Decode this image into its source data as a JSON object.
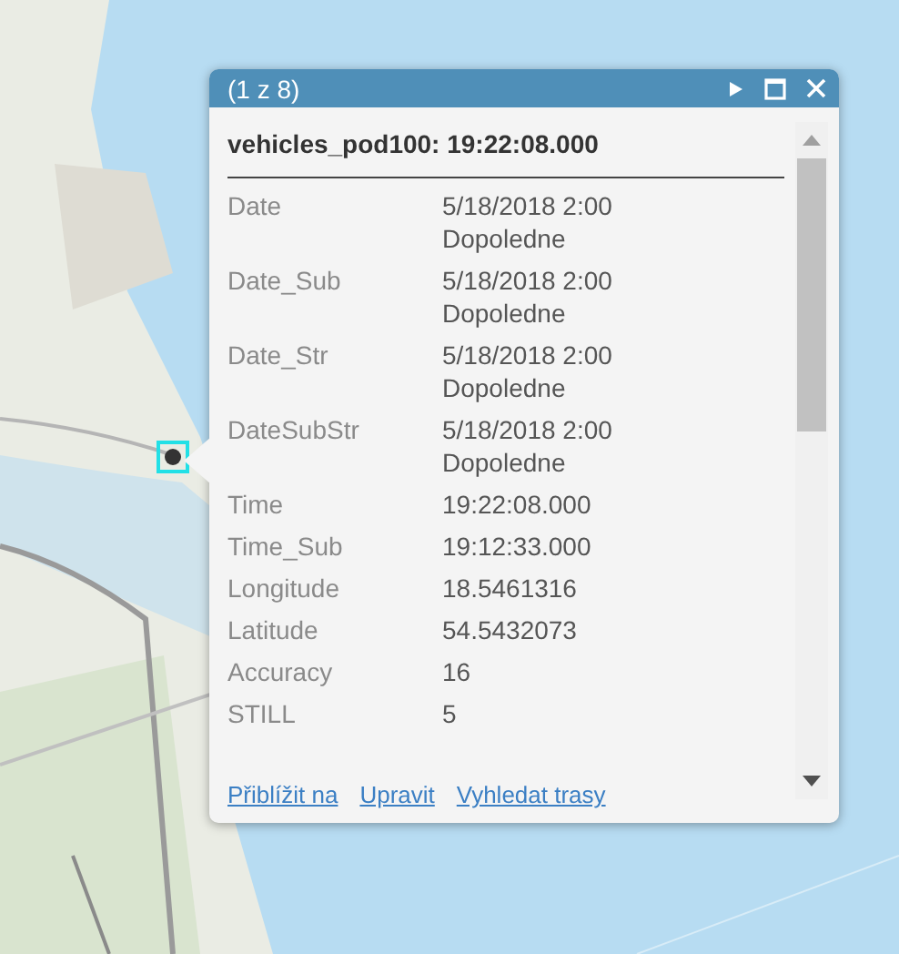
{
  "popup": {
    "title": "(1 z 8)",
    "heading": "vehicles_pod100: 19:22:08.000",
    "fields": [
      {
        "label": "Date",
        "value": "5/18/2018 2:00 Dopoledne"
      },
      {
        "label": "Date_Sub",
        "value": "5/18/2018 2:00 Dopoledne"
      },
      {
        "label": "Date_Str",
        "value": "5/18/2018 2:00 Dopoledne"
      },
      {
        "label": "DateSubStr",
        "value": "5/18/2018 2:00 Dopoledne"
      },
      {
        "label": "Time",
        "value": "19:22:08.000"
      },
      {
        "label": "Time_Sub",
        "value": "19:12:33.000"
      },
      {
        "label": "Longitude",
        "value": "18.5461316"
      },
      {
        "label": "Latitude",
        "value": "54.5432073"
      },
      {
        "label": "Accuracy",
        "value": "16"
      },
      {
        "label": "STILL",
        "value": "5"
      }
    ],
    "actions": [
      "Přiblížit na",
      "Upravit",
      "Vyhledat trasy"
    ]
  }
}
